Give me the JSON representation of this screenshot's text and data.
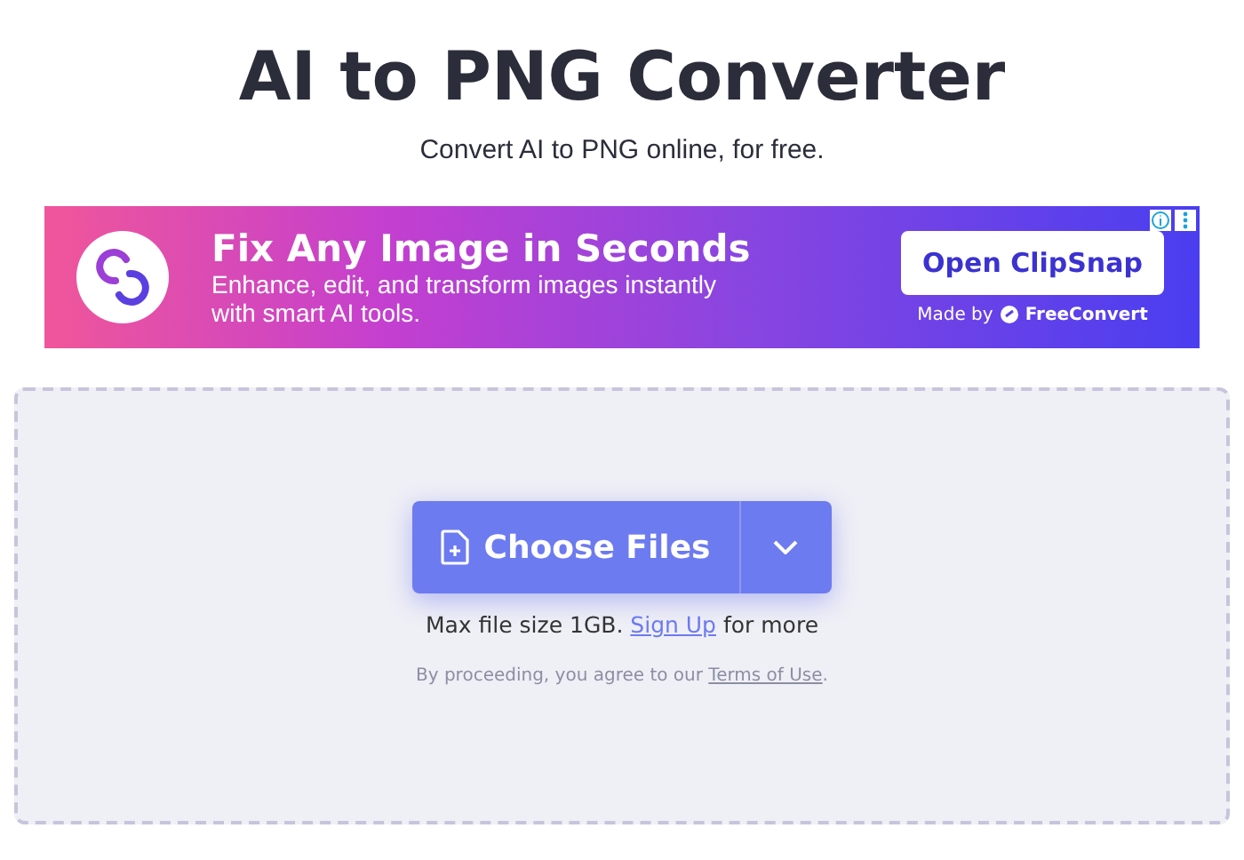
{
  "title": "AI to PNG Converter",
  "subtitle": "Convert AI to PNG online, for free.",
  "ad": {
    "headline": "Fix Any Image in Seconds",
    "body": "Enhance, edit, and transform images instantly with smart AI tools.",
    "button": "Open ClipSnap",
    "made_by": "Made by",
    "brand": "FreeConvert"
  },
  "upload": {
    "button": "Choose Files",
    "limit_before": "Max file size 1GB.",
    "limit_link": "Sign Up",
    "limit_after": "for more",
    "terms_before": "By proceeding, you agree to our",
    "terms_link": "Terms of Use",
    "terms_after": "."
  }
}
